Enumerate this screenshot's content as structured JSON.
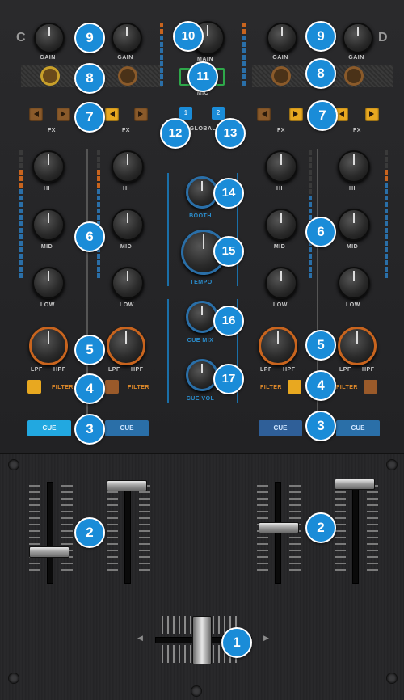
{
  "deck_letters": {
    "left": "C",
    "right": "D"
  },
  "labels": {
    "gain": "GAIN",
    "fx": "FX",
    "hi": "HI",
    "mid": "MID",
    "low": "LOW",
    "lpf": "LPF",
    "hpf": "HPF",
    "filter": "FILTER",
    "cue": "CUE",
    "mic": "MIC",
    "global": "GLOBAL",
    "booth": "BOOTH",
    "tempo": "TEMPO",
    "cue_mix": "CUE MIX",
    "cue_vol": "CUE VOL",
    "minus": "–",
    "plus": "+",
    "main": "MAIN"
  },
  "mic_button": {
    "left": "1",
    "right": "2"
  },
  "global_buttons": [
    "1",
    "2"
  ],
  "badges": [
    "1",
    "2",
    "3",
    "4",
    "5",
    "6",
    "7",
    "8",
    "9",
    "10",
    "11",
    "12",
    "13",
    "14",
    "15",
    "16",
    "17"
  ],
  "colors": {
    "badge": "#1a8cd8",
    "orange": "#c8641e",
    "amber": "#e8a820",
    "cue_blue": "#2a6fa8",
    "cue_active": "#22a8e0",
    "mic_green": "#2ea84a"
  }
}
